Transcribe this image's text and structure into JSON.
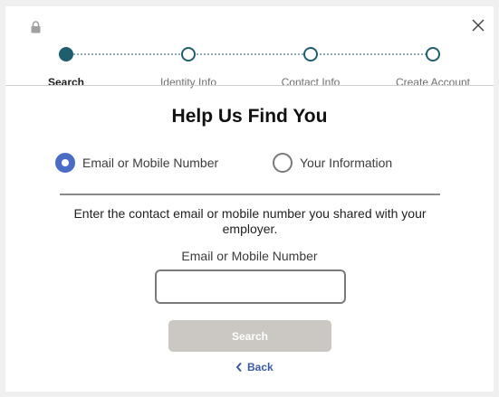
{
  "header": {
    "lock_icon": "lock-icon",
    "close_icon": "close-icon"
  },
  "stepper": {
    "active_color": "#1e5e6e",
    "steps": [
      {
        "label": "Search",
        "state": "active"
      },
      {
        "label": "Identity Info",
        "state": "upcoming"
      },
      {
        "label": "Contact Info",
        "state": "upcoming"
      },
      {
        "label": "Create Account",
        "state": "upcoming"
      }
    ]
  },
  "main": {
    "title": "Help Us Find You",
    "options": [
      {
        "label": "Email or Mobile Number",
        "selected": true
      },
      {
        "label": "Your Information",
        "selected": false
      }
    ],
    "instructions": "Enter the contact email or mobile number you shared with your employer.",
    "field_label": "Email or Mobile Number",
    "field_value": "",
    "search_label": "Search",
    "search_disabled": true,
    "back_label": "Back"
  },
  "colors": {
    "accent": "#4a6cc4",
    "button_disabled": "#cbc7c2",
    "link": "#3a5aa8"
  }
}
